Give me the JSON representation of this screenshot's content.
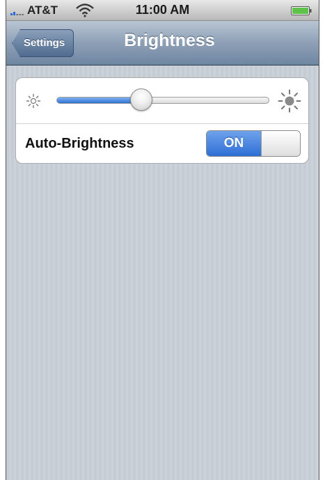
{
  "status_bar": {
    "carrier": "AT&T",
    "time": "11:00 AM",
    "icons": [
      "signal-icon",
      "wifi-icon",
      "battery-icon"
    ]
  },
  "nav_bar": {
    "back_label": "Settings",
    "title": "Brightness"
  },
  "brightness": {
    "level": 0.4,
    "min_icon": "sun-small-icon",
    "max_icon": "sun-large-icon"
  },
  "auto_brightness": {
    "label": "Auto-Brightness",
    "state_label": "ON",
    "enabled": true
  },
  "colors": {
    "accent": "#2e6fd5",
    "nav_bar": "#8ea0b6",
    "background": "#c5ccd4"
  }
}
